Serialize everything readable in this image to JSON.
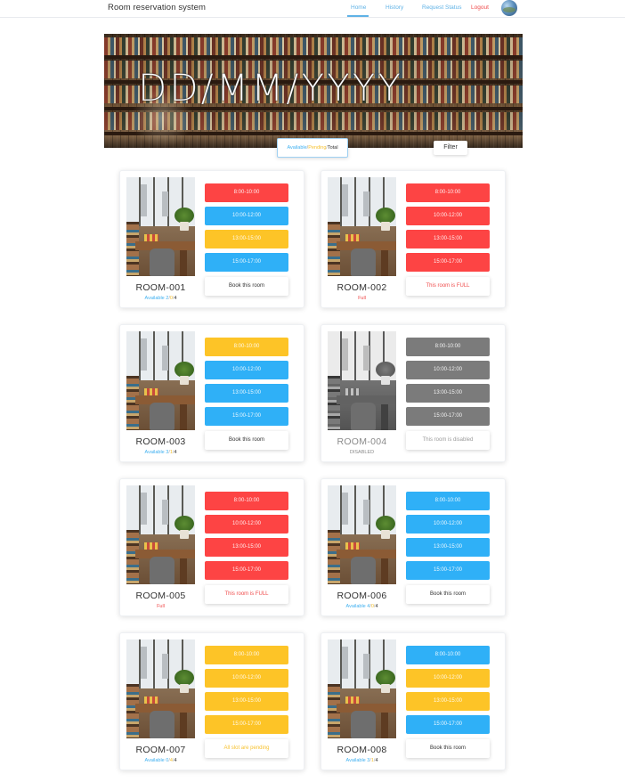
{
  "app": {
    "title": "Room reservation system"
  },
  "nav": {
    "home": "Home",
    "history": "History",
    "request_status": "Request Status",
    "logout": "Logout"
  },
  "banner": {
    "date": "DD/MM/YYYY"
  },
  "legend": {
    "available": "Available",
    "sep": "/",
    "pending": "Pending",
    "total": "Total"
  },
  "filter_label": "Filter",
  "colors": {
    "full": "#fd4444",
    "available": "#2fb0f7",
    "pending": "#fdc427",
    "disabled": "#7b7b7b",
    "accent": "#5fb2e6"
  },
  "rooms": [
    {
      "name": "ROOM-001",
      "status": {
        "available": "Available 2",
        "pending": "0",
        "total": "4"
      },
      "slots": [
        {
          "label": "8:00-10:00",
          "state": "full"
        },
        {
          "label": "10:00-12:00",
          "state": "available"
        },
        {
          "label": "13:00-15:00",
          "state": "pending"
        },
        {
          "label": "15:00-17:00",
          "state": "available"
        }
      ],
      "action": "Book this room"
    },
    {
      "name": "ROOM-002",
      "status_text": "Full",
      "slots": [
        {
          "label": "8:00-10:00",
          "state": "full"
        },
        {
          "label": "10:00-12:00",
          "state": "full"
        },
        {
          "label": "13:00-15:00",
          "state": "full"
        },
        {
          "label": "15:00-17:00",
          "state": "full"
        }
      ],
      "action": "This room is FULL"
    },
    {
      "name": "ROOM-003",
      "status": {
        "available": "Available 3",
        "pending": "1",
        "total": "4"
      },
      "slots": [
        {
          "label": "8:00-10:00",
          "state": "pending"
        },
        {
          "label": "10:00-12:00",
          "state": "available"
        },
        {
          "label": "13:00-15:00",
          "state": "available"
        },
        {
          "label": "15:00-17:00",
          "state": "available"
        }
      ],
      "action": "Book this room"
    },
    {
      "name": "ROOM-004",
      "status_text": "DISABLED",
      "slots": [
        {
          "label": "8:00-10:00",
          "state": "disabled"
        },
        {
          "label": "10:00-12:00",
          "state": "disabled"
        },
        {
          "label": "13:00-15:00",
          "state": "disabled"
        },
        {
          "label": "15:00-17:00",
          "state": "disabled"
        }
      ],
      "action": "This room is disabled"
    },
    {
      "name": "ROOM-005",
      "status_text": "Full",
      "slots": [
        {
          "label": "8:00-10:00",
          "state": "full"
        },
        {
          "label": "10:00-12:00",
          "state": "full"
        },
        {
          "label": "13:00-15:00",
          "state": "full"
        },
        {
          "label": "15:00-17:00",
          "state": "full"
        }
      ],
      "action": "This room is FULL"
    },
    {
      "name": "ROOM-006",
      "status": {
        "available": "Available 4",
        "pending": "0",
        "total": "4"
      },
      "slots": [
        {
          "label": "8:00-10:00",
          "state": "available"
        },
        {
          "label": "10:00-12:00",
          "state": "available"
        },
        {
          "label": "13:00-15:00",
          "state": "available"
        },
        {
          "label": "15:00-17:00",
          "state": "available"
        }
      ],
      "action": "Book this room"
    },
    {
      "name": "ROOM-007",
      "status": {
        "available": "Available 0",
        "pending": "4",
        "total": "4"
      },
      "slots": [
        {
          "label": "8:00-10:00",
          "state": "pending"
        },
        {
          "label": "10:00-12:00",
          "state": "pending"
        },
        {
          "label": "13:00-15:00",
          "state": "pending"
        },
        {
          "label": "15:00-17:00",
          "state": "pending"
        }
      ],
      "action": "All slot are pending"
    },
    {
      "name": "ROOM-008",
      "status": {
        "available": "Available 3",
        "pending": "1",
        "total": "4"
      },
      "slots": [
        {
          "label": "8:00-10:00",
          "state": "available"
        },
        {
          "label": "10:00-12:00",
          "state": "pending"
        },
        {
          "label": "13:00-15:00",
          "state": "pending"
        },
        {
          "label": "15:00-17:00",
          "state": "available"
        }
      ],
      "action": "Book this room"
    }
  ]
}
